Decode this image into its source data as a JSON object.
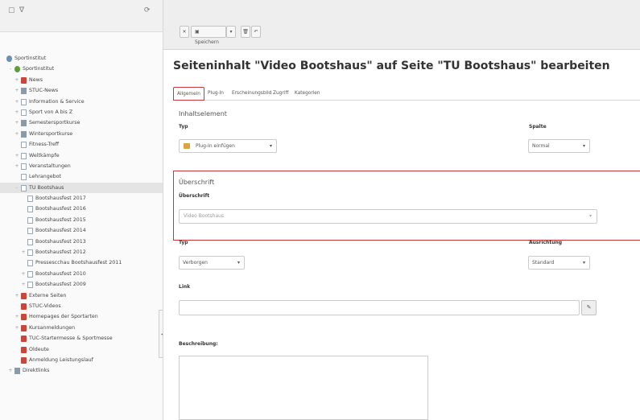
{
  "tree": {
    "root_label": "Sportinstitut",
    "items": [
      {
        "label": "Sportinstitut",
        "indent": 1,
        "icon": "green",
        "exp": "-"
      },
      {
        "label": "News",
        "indent": 2,
        "icon": "red",
        "exp": "+"
      },
      {
        "label": "STUC-News",
        "indent": 2,
        "icon": "folder",
        "exp": "+"
      },
      {
        "label": "Information & Service",
        "indent": 2,
        "icon": "page",
        "exp": "+"
      },
      {
        "label": "Sport von A bis Z",
        "indent": 2,
        "icon": "page",
        "exp": "+"
      },
      {
        "label": "Semestersportkurse",
        "indent": 2,
        "icon": "folder",
        "exp": "+"
      },
      {
        "label": "Wintersportkurse",
        "indent": 2,
        "icon": "folder",
        "exp": "+"
      },
      {
        "label": "Fitness-Treff",
        "indent": 2,
        "icon": "page",
        "exp": ""
      },
      {
        "label": "Weltkämpfe",
        "indent": 2,
        "icon": "page",
        "exp": "+"
      },
      {
        "label": "Veranstaltungen",
        "indent": 2,
        "icon": "page",
        "exp": "+"
      },
      {
        "label": "Lehrangebot",
        "indent": 2,
        "icon": "page",
        "exp": ""
      },
      {
        "label": "TU Bootshaus",
        "indent": 2,
        "icon": "page",
        "exp": "-",
        "selected": true
      },
      {
        "label": "Bootshausfest 2017",
        "indent": 3,
        "icon": "page",
        "exp": ""
      },
      {
        "label": "Bootshausfest 2016",
        "indent": 3,
        "icon": "page",
        "exp": ""
      },
      {
        "label": "Bootshausfest 2015",
        "indent": 3,
        "icon": "page",
        "exp": ""
      },
      {
        "label": "Bootshausfest 2014",
        "indent": 3,
        "icon": "page",
        "exp": ""
      },
      {
        "label": "Bootshausfest 2013",
        "indent": 3,
        "icon": "page",
        "exp": ""
      },
      {
        "label": "Bootshausfest 2012",
        "indent": 3,
        "icon": "page",
        "exp": "+"
      },
      {
        "label": "Pressescchau Bootshausfest 2011",
        "indent": 3,
        "icon": "page",
        "exp": ""
      },
      {
        "label": "Bootshausfest 2010",
        "indent": 3,
        "icon": "page",
        "exp": "+"
      },
      {
        "label": "Bootshausfest 2009",
        "indent": 3,
        "icon": "page",
        "exp": "+"
      },
      {
        "label": "Externe Seiten",
        "indent": 2,
        "icon": "red",
        "exp": "+"
      },
      {
        "label": "STUC-Videos",
        "indent": 2,
        "icon": "red",
        "exp": ""
      },
      {
        "label": "Homepages der Sportarten",
        "indent": 2,
        "icon": "red",
        "exp": "+"
      },
      {
        "label": "Kursanmeldungen",
        "indent": 2,
        "icon": "red",
        "exp": "+"
      },
      {
        "label": "TUC-Startermesse & Sportmesse",
        "indent": 2,
        "icon": "red",
        "exp": ""
      },
      {
        "label": "Oldeute",
        "indent": 2,
        "icon": "red",
        "exp": ""
      },
      {
        "label": "Anmeldung Leistungslauf",
        "indent": 2,
        "icon": "red",
        "exp": ""
      },
      {
        "label": "Direktlinks",
        "indent": 1,
        "icon": "folder",
        "exp": "+"
      }
    ]
  },
  "toolbar": {
    "save_label": "Speichern"
  },
  "page_title": "Seiteninhalt \"Video Bootshaus\" auf Seite \"TU Bootshaus\" bearbeiten",
  "tabs": [
    "Allgemein",
    "Plug-In",
    "Erscheinungsbild",
    "Zugriff",
    "Kategorien"
  ],
  "content_element": {
    "section_title": "Inhaltselement",
    "type_label": "Typ",
    "type_value": "Plug-In einfügen",
    "column_label": "Spalte",
    "column_value": "Normal"
  },
  "header": {
    "section_title": "Überschrift",
    "field_label": "Überschrift",
    "field_value": "Video Bootshaus",
    "type_label": "Typ",
    "type_value": "Verborgen",
    "align_label": "Ausrichtung",
    "align_value": "Standard",
    "link_label": "Link",
    "link_value": ""
  },
  "description": {
    "label": "Beschreibung:"
  },
  "colors": {
    "accent_red": "#c9363b"
  }
}
